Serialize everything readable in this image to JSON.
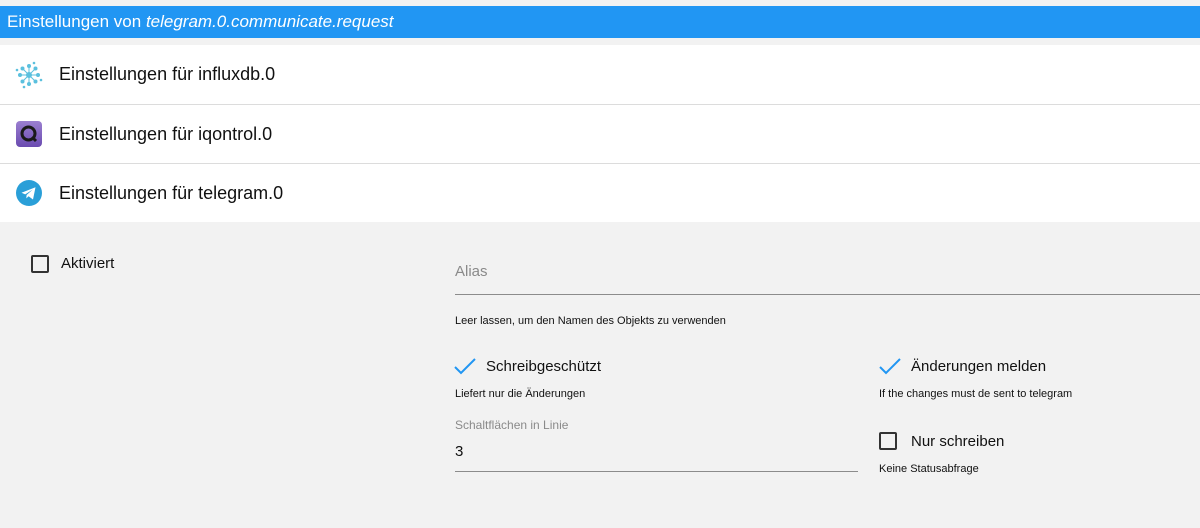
{
  "header": {
    "title_prefix": "Einstellungen von ",
    "object_id": "telegram.0.communicate.request",
    "bg_color": "#2196f3"
  },
  "adapters": [
    {
      "label": "Einstellungen für influxdb.0",
      "icon": "influxdb-icon"
    },
    {
      "label": "Einstellungen für iqontrol.0",
      "icon": "iqontrol-icon"
    },
    {
      "label": "Einstellungen für telegram.0",
      "icon": "telegram-icon"
    }
  ],
  "settings": {
    "enabled_label": "Aktiviert",
    "enabled_checked": false,
    "alias_placeholder": "Alias",
    "alias_hint": "Leer lassen, um den Namen des Objekts zu verwenden",
    "readonly_label": "Schreibgeschützt",
    "readonly_checked": true,
    "readonly_hint": "Liefert nur die Änderungen",
    "report_changes_label": "Änderungen melden",
    "report_changes_checked": true,
    "report_changes_hint": "If the changes must de sent to telegram",
    "buttons_per_line_label": "Schaltflächen in Linie",
    "buttons_per_line_value": "3",
    "write_only_label": "Nur schreiben",
    "write_only_checked": false,
    "write_only_hint": "Keine Statusabfrage"
  },
  "colors": {
    "accent": "#2196f3",
    "check": "#2196f3"
  }
}
